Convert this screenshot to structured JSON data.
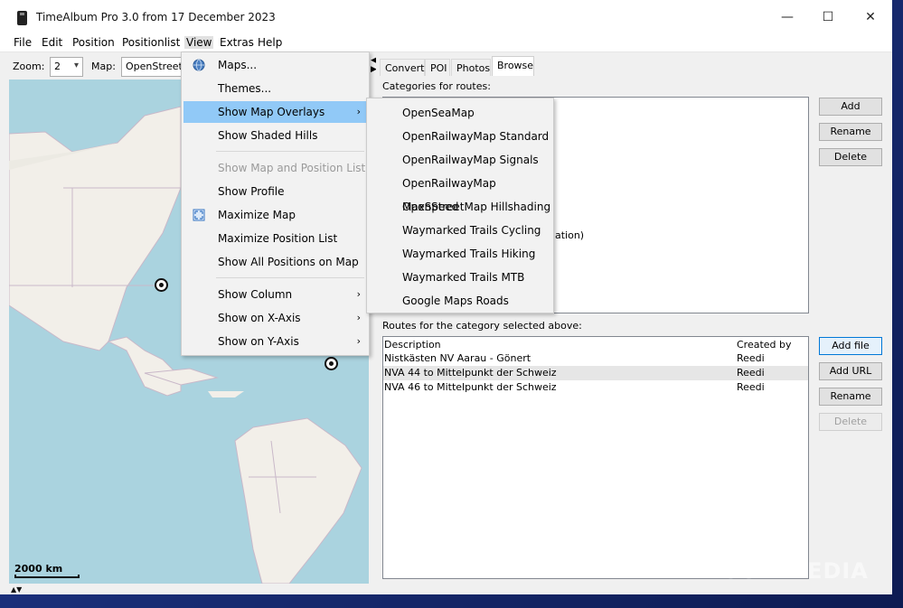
{
  "window": {
    "title": "TimeAlbum Pro 3.0 from 17 December 2023",
    "min": "—",
    "max": "☐",
    "close": "✕"
  },
  "menubar": [
    "File",
    "Edit",
    "Position",
    "Positionlist",
    "View",
    "Extras",
    "Help"
  ],
  "toolbar": {
    "zoom_label": "Zoom:",
    "zoom_value": "2",
    "map_label": "Map:",
    "map_value": "OpenStreetM"
  },
  "map": {
    "scale": "2000 km",
    "arrows": "▲▼"
  },
  "tabs": [
    "Convert",
    "POI",
    "Photos",
    "Browse"
  ],
  "categories": {
    "label": "Categories for routes:",
    "partial_text": "ation)"
  },
  "category_buttons": {
    "add": "Add",
    "rename": "Rename",
    "delete": "Delete"
  },
  "routes": {
    "label": "Routes for the category selected above:",
    "columns": [
      "Description",
      "Created by"
    ],
    "rows": [
      {
        "description": "Nistkästen NV Aarau - Gönert",
        "created_by": "Reedi"
      },
      {
        "description": "NVA 44 to Mittelpunkt der Schweiz",
        "created_by": "Reedi"
      },
      {
        "description": "NVA 46 to Mittelpunkt der Schweiz",
        "created_by": "Reedi"
      }
    ]
  },
  "route_buttons": {
    "add_file": "Add file",
    "add_url": "Add URL",
    "rename": "Rename",
    "delete": "Delete"
  },
  "view_menu": {
    "items": [
      {
        "label": "Maps...",
        "icon": "globe-icon"
      },
      {
        "label": "Themes..."
      },
      {
        "label": "Show Map Overlays",
        "submenu": true,
        "highlighted": true
      },
      {
        "label": "Show Shaded Hills"
      },
      {
        "label": "Show Map and Position List",
        "disabled": true
      },
      {
        "label": "Show Profile"
      },
      {
        "label": "Maximize Map",
        "icon": "maximize-icon"
      },
      {
        "label": "Maximize Position List"
      },
      {
        "label": "Show All Positions on Map"
      },
      {
        "label": "Show Column",
        "submenu": true
      },
      {
        "label": "Show on X-Axis",
        "submenu": true
      },
      {
        "label": "Show on Y-Axis",
        "submenu": true
      }
    ]
  },
  "overlay_submenu": [
    "OpenSeaMap",
    "OpenRailwayMap Standard",
    "OpenRailwayMap Signals",
    "OpenRailwayMap MaxSpeed",
    "OpenStreetMap Hillshading",
    "Waymarked Trails Cycling",
    "Waymarked Trails Hiking",
    "Waymarked Trails MTB",
    "Google Maps Roads"
  ],
  "watermark": "SOFTPEDIA",
  "colors": {
    "highlight": "#91c9f7",
    "water": "#aad3df",
    "land": "#f2efe9",
    "focus": "#0078d7"
  }
}
